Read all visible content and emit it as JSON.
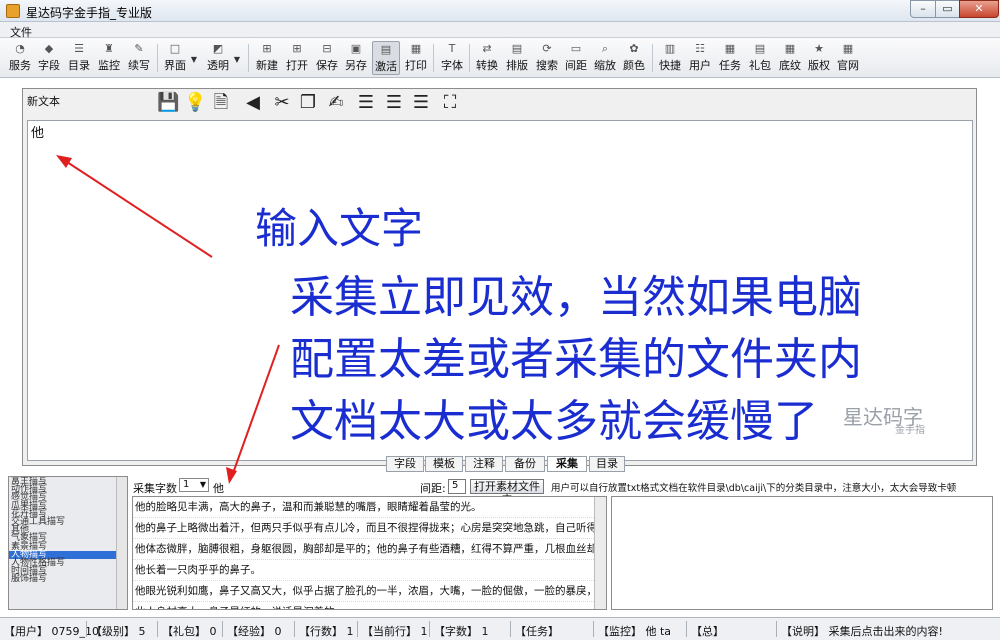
{
  "window": {
    "title": "星达码字金手指_专业版",
    "min_label": "0",
    "max_label": "1",
    "close_label": "r"
  },
  "menu": {
    "file": "文件"
  },
  "toolbar": {
    "items": [
      "服务",
      "字段",
      "目录",
      "监控",
      "续写",
      "界面",
      "透明",
      "新建",
      "打开",
      "保存",
      "另存",
      "激活",
      "打印",
      "字体",
      "转换",
      "排版",
      "搜索",
      "间距",
      "缩放",
      "颜色",
      "快捷",
      "用户",
      "任务",
      "礼包",
      "底纹",
      "版权",
      "官网"
    ],
    "pressed": "激活"
  },
  "editor": {
    "doc_title": "新文本",
    "content": "他",
    "annotation_main": "输入文字",
    "annotation_lines": [
      "采集立即见效，当然如果电脑",
      "配置太差或者采集的文件夹内",
      "文档太大或太多就会缓慢了"
    ],
    "watermark": "星达码字",
    "watermark_sub": "金手指"
  },
  "tabs": {
    "items": [
      "字段",
      "模板",
      "注释",
      "备份",
      "采集",
      "目录"
    ],
    "active": "采集"
  },
  "collect": {
    "count_label": "采集字数",
    "count_value": "1",
    "keyword": "他",
    "interval_label": "间距:",
    "interval_value": "5",
    "open_folder": "打开素材文件夹",
    "hint": "用户可以自行放置txt格式文档在软件目录\\db\\caiji\\下的分类目录中，注意大小，太大会导致卡顿"
  },
  "categories": [
    "富主描写",
    "动作描写",
    "感觉描写",
    "瓜果描写",
    "花卉描写",
    "交通工具描写",
    "其他",
    "气象描写",
    "素景描写",
    "人物描写",
    "人物性格描写",
    "时间描写",
    "服饰描写"
  ],
  "selected_category": "人物描写",
  "results": [
    "他的脸略见丰满，高大的鼻子，温和而兼聪慧的嘴唇，眼睛耀着晶莹的光。",
    "他的鼻子上略微出着汗，但两只手似乎有点儿冷，而且不很捏得拢来；心房是突突地急跳，自己听得见那不",
    "他体态微胖，脑膊很粗，身躯很圆，胸部却是平的；他的鼻子有些酒糟，红得不算严重，几根血丝却很明显。",
    "他长着一只肉乎乎的鼻子。",
    "他眼光锐利如鹰，鼻子又高又大，似乎占据了脸孔的一半，浓眉，大嘴，一脸的倔傲，一脸的暴戾，一脸的炫",
    "此人身材高大，鼻子是红的，说话是沉着的。"
  ],
  "status": [
    {
      "label": "【用户】",
      "value": "0759_10"
    },
    {
      "label": "【级别】",
      "value": "5"
    },
    {
      "label": "【礼包】",
      "value": "0"
    },
    {
      "label": "【经验】",
      "value": "0"
    },
    {
      "label": "【行数】",
      "value": "1"
    },
    {
      "label": "【当前行】",
      "value": "1"
    },
    {
      "label": "【字数】",
      "value": "1"
    },
    {
      "label": "【任务】",
      "value": ""
    },
    {
      "label": "【监控】",
      "value": "他 ta"
    },
    {
      "label": "【总】",
      "value": ""
    },
    {
      "label": "【说明】",
      "value": "采集后点击出来的内容!"
    }
  ],
  "colors": {
    "annotation": "#1a2dd0",
    "selection": "#2f6fd8"
  }
}
